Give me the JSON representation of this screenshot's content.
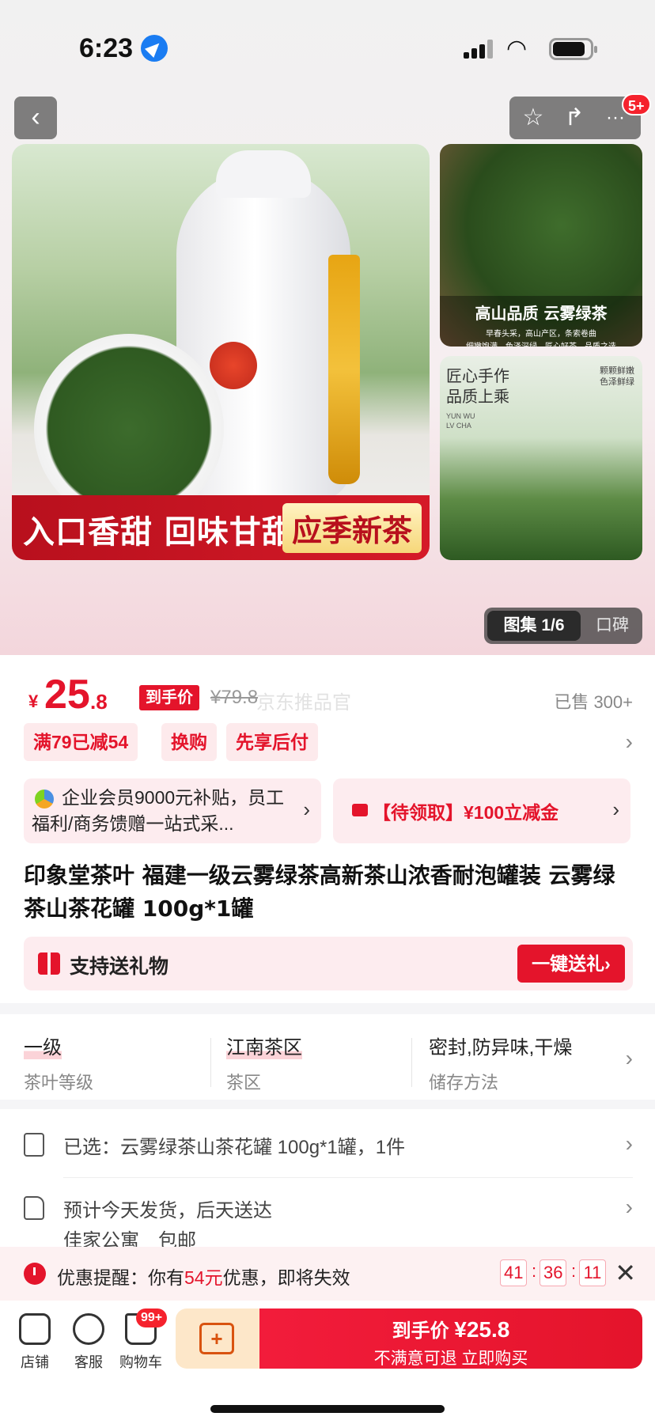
{
  "status_bar": {
    "time": "6:23"
  },
  "nav": {
    "back": "‹",
    "star": "☆",
    "share": "↱",
    "more": "···",
    "badge": "5+"
  },
  "gallery": {
    "banner_left": "入口香甜 回味甘甜",
    "banner_right": "应季新茶",
    "thumb1_title": "高山品质 云雾绿茶",
    "thumb1_sub1": "早春头采，高山产区，条索卷曲",
    "thumb1_sub2": "细嫩饱满，色泽深绿，匠心好茶，品质之选",
    "thumb2_title_1": "匠心手作",
    "thumb2_title_2": "品质上乘",
    "thumb2_en": "YUN WU LV CHA",
    "thumb2_right_1": "颗颗鲜嫩",
    "thumb2_right_2": "色泽鲜绿",
    "album_current": "图集 1/6",
    "album_other": "口碑"
  },
  "price": {
    "currency": "¥",
    "int": "25",
    "dec": ".8",
    "tag": "到手价",
    "original": "¥79.8",
    "watermark": "京东推品官",
    "sold": "已售 300+"
  },
  "promos": [
    "满79已减54",
    "换购",
    "先享后付"
  ],
  "cards": {
    "enterprise": "企业会员9000元补贴，员工福利/商务馈赠一站式采...",
    "coupon": "【待领取】¥100立减金"
  },
  "title": "印象堂茶叶 福建一级云雾绿茶高新茶山浓香耐泡罐装 云雾绿茶山茶花罐 100g*1罐",
  "gift": {
    "label": "支持送礼物",
    "button": "一键送礼›"
  },
  "specs": [
    {
      "value": "一级",
      "key": "茶叶等级"
    },
    {
      "value": "江南茶区",
      "key": "茶区"
    },
    {
      "value": "密封,防异味,干燥",
      "key": "储存方法"
    }
  ],
  "rows": {
    "selected": "已选：云雾绿茶山茶花罐 100g*1罐，1件",
    "delivery": "预计今天发货，后天送达",
    "address": "佳家公寓　包邮"
  },
  "reminder": {
    "prefix": "优惠提醒：你有",
    "amount": "54元",
    "suffix": "优惠，即将失效",
    "h": "41",
    "m": "36",
    "s": "11",
    "close": "✕"
  },
  "bottom": {
    "store": "店铺",
    "service": "客服",
    "cart": "购物车",
    "cart_badge": "99+",
    "buy_label": "到手价",
    "buy_price": "¥25.8",
    "buy_sub": "不满意可退 立即购买"
  },
  "colors": {
    "accent": "#e4142b",
    "gift_bg": "#fdecef"
  }
}
